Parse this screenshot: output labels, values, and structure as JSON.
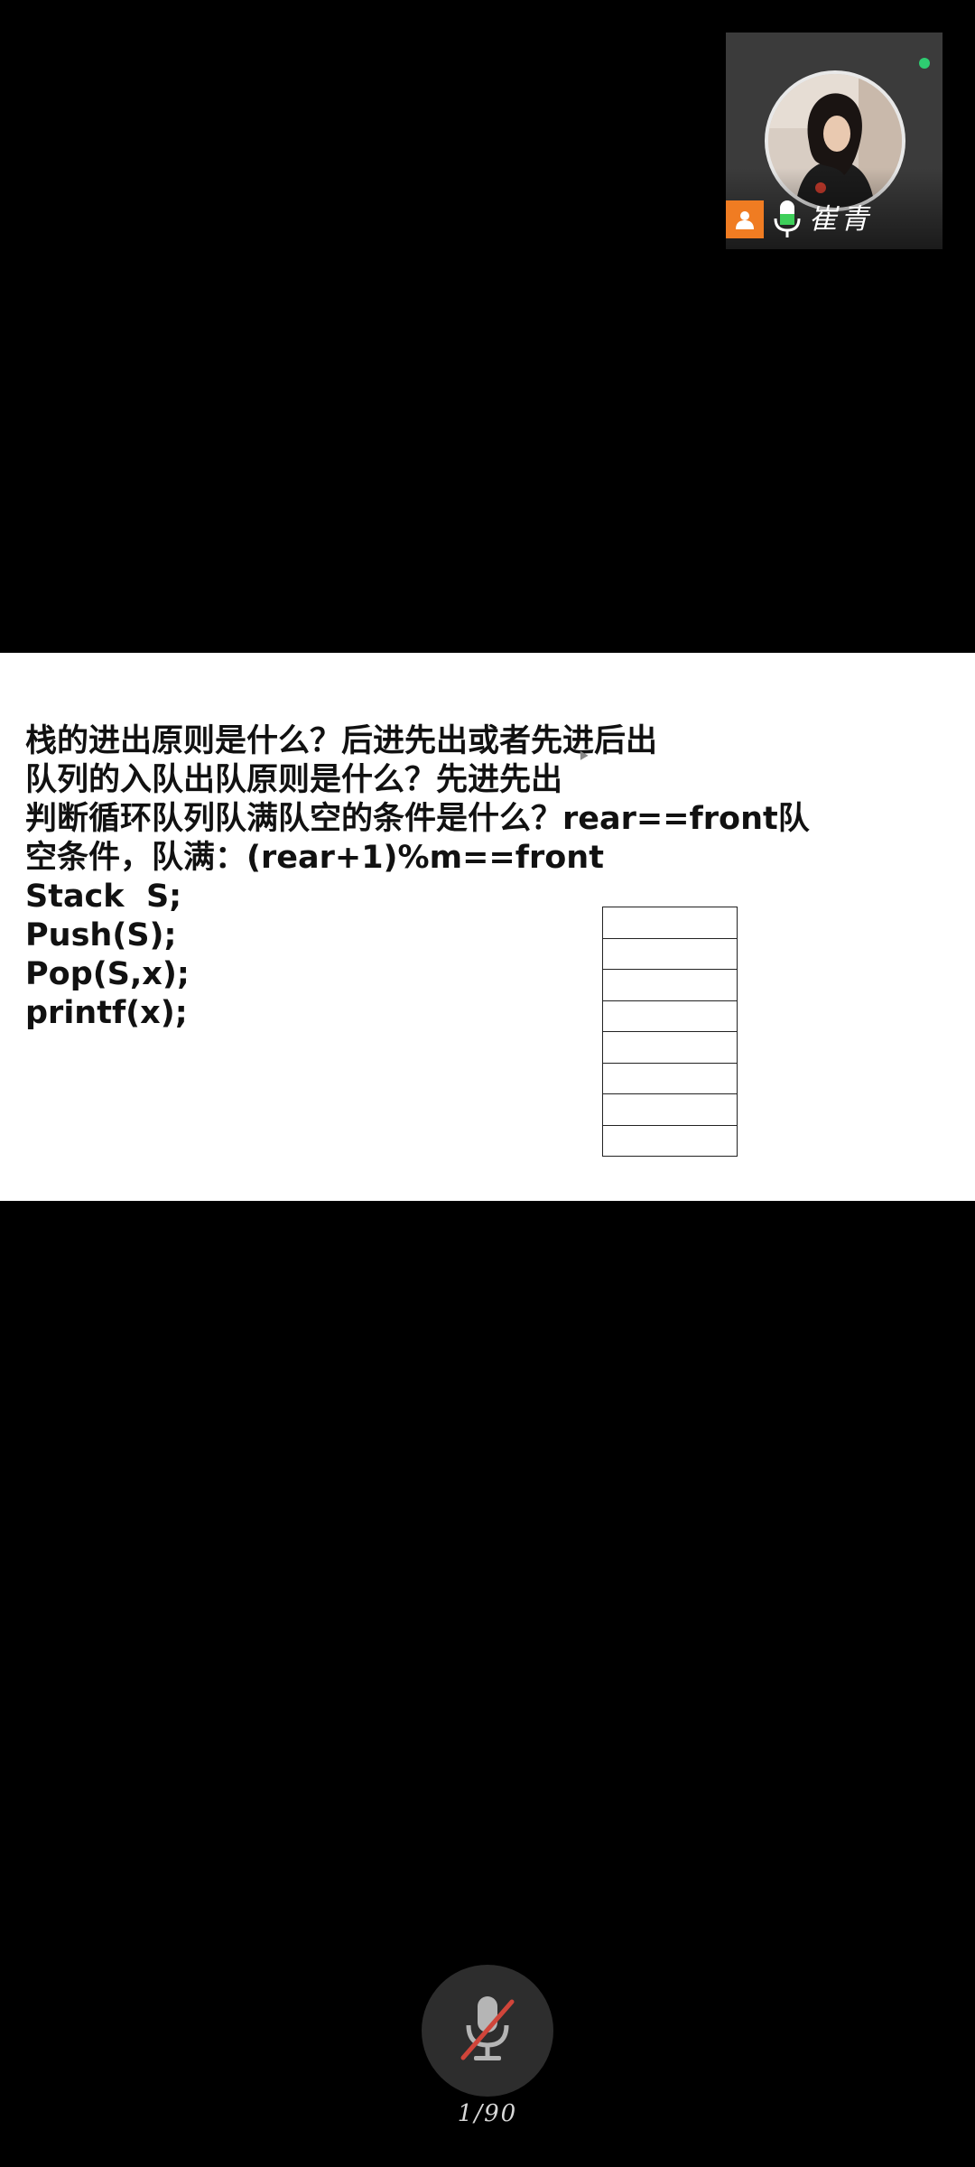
{
  "participant": {
    "name": "崔青",
    "online_color": "#2ecc71",
    "badge_icon": "host-person-icon",
    "badge_color": "#f07c22",
    "mic_icon": "microphone-icon"
  },
  "slide": {
    "lines": [
      "栈的进出原则是什么？后进先出或者先进后出",
      "队列的入队出队原则是什么？先进先出",
      "判断循环队列队满队空的条件是什么？rear==front队",
      "空条件，队满：(rear+1)%m==front",
      "Stack  S;",
      "Push(S);",
      "Pop(S,x);",
      "printf(x);"
    ],
    "stack_diagram_cells": 8
  },
  "controls": {
    "mic_icon": "microphone-muted-icon",
    "mic_state": "muted",
    "page_counter": "1/90"
  }
}
